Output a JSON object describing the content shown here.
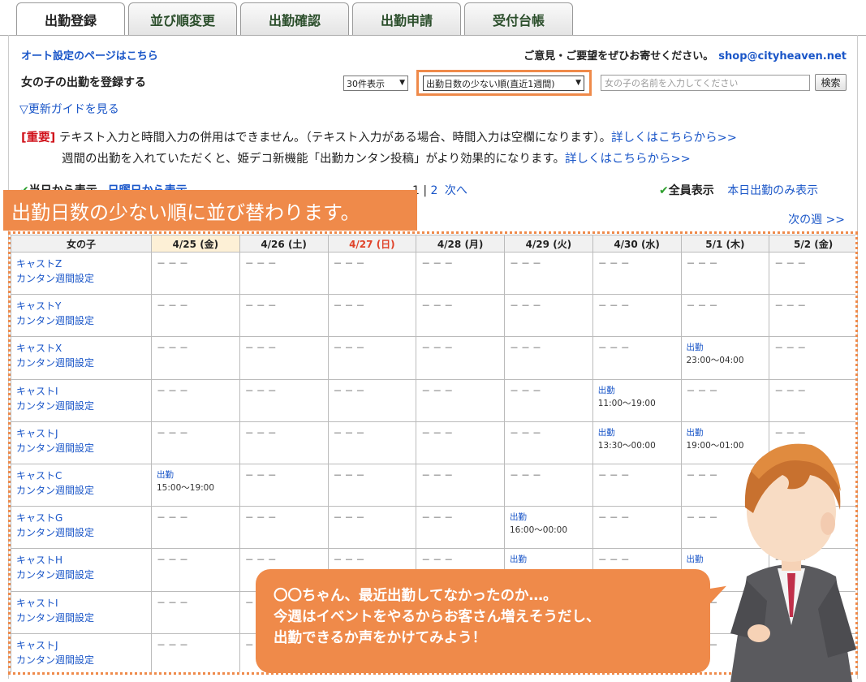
{
  "tabs": [
    "出勤登録",
    "並び順変更",
    "出勤確認",
    "出勤申請",
    "受付台帳"
  ],
  "auto_link": "オート設定のページはこちら",
  "feedback": {
    "text": "ご意見・ご要望をぜひお寄せください。",
    "email": "shop@cityheaven.net"
  },
  "register_title": "女の子の出勤を登録する",
  "display_count": "30件表示",
  "sort_select": "出勤日数の少ない順(直近1週間)",
  "search": {
    "placeholder": "女の子の名前を入力してください",
    "button": "検索"
  },
  "guide_link": "▽更新ガイドを見る",
  "notice": {
    "important": "[重要]",
    "line1": "テキスト入力と時間入力の併用はできません。（テキスト入力がある場合、時間入力は空欄になります）。",
    "line1_link": "詳しくはこちらから>>",
    "line2": "週間の出勤を入れていただくと、姫デコ新機能「出勤カンタン投稿」がより効果的になります。",
    "line2_link": "詳しくはこちらから>>"
  },
  "options": {
    "from_today": "当日から表示",
    "from_sunday": "日曜日から表示",
    "page1": "1",
    "page2": "2",
    "next": "次へ",
    "show_all": "全員表示",
    "today_only": "本日出勤のみ表示",
    "next_week": "次の週 >>"
  },
  "banner": "出勤日数の少ない順に並び替わります。",
  "table": {
    "header_cast": "女の子",
    "dates": [
      "4/25 (金)",
      "4/26 (土)",
      "4/27 (日)",
      "4/28 (月)",
      "4/29 (火)",
      "4/30 (水)",
      "5/1 (木)",
      "5/2 (金)"
    ],
    "link_label": "カンタン週間設定",
    "no_shift": "－－－",
    "shift_label": "出勤",
    "rows": [
      {
        "name": "キャストZ",
        "shifts": [
          "",
          "",
          "",
          "",
          "",
          "",
          "",
          ""
        ]
      },
      {
        "name": "キャストY",
        "shifts": [
          "",
          "",
          "",
          "",
          "",
          "",
          "",
          ""
        ]
      },
      {
        "name": "キャストX",
        "shifts": [
          "",
          "",
          "",
          "",
          "",
          "",
          "23:00～04:00",
          ""
        ]
      },
      {
        "name": "キャストI",
        "shifts": [
          "",
          "",
          "",
          "",
          "",
          "11:00～19:00",
          "",
          ""
        ]
      },
      {
        "name": "キャストJ",
        "shifts": [
          "",
          "",
          "",
          "",
          "",
          "13:30～00:00",
          "19:00～01:00",
          ""
        ]
      },
      {
        "name": "キャストC",
        "shifts": [
          "15:00～19:00",
          "",
          "",
          "",
          "",
          "",
          "",
          ""
        ]
      },
      {
        "name": "キャストG",
        "shifts": [
          "",
          "",
          "",
          "",
          "16:00～00:00",
          "",
          "",
          ""
        ]
      },
      {
        "name": "キャストH",
        "shifts": [
          "",
          "",
          "",
          "",
          "*",
          "",
          "*",
          ""
        ]
      },
      {
        "name": "キャストI",
        "shifts": [
          "",
          "",
          "",
          "",
          "",
          "",
          "",
          ""
        ]
      },
      {
        "name": "キャストJ",
        "shifts": [
          "",
          "",
          "",
          "",
          "",
          "",
          "",
          ""
        ]
      }
    ]
  },
  "bubble": {
    "line1": "〇〇ちゃん、最近出勤してなかったのか…。",
    "line2": "今週はイベントをやるからお客さん増えそうだし、",
    "line3": "出勤できるか声をかけてみよう！"
  },
  "colors": {
    "accent": "#ef8a4a",
    "link": "#1a56c8",
    "important": "#d0121b",
    "check": "#2d9f2d",
    "sunday": "#e0432a"
  }
}
